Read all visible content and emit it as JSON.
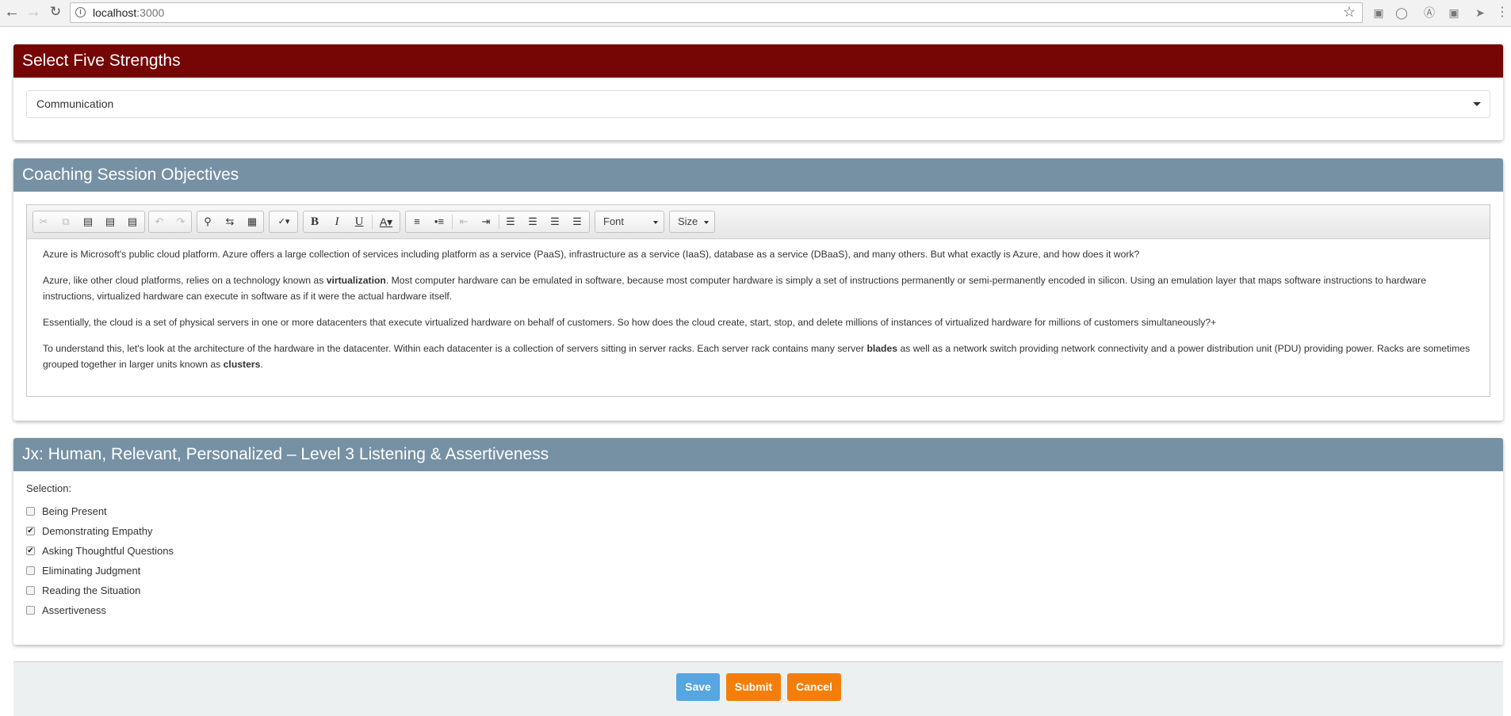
{
  "browser": {
    "url_host": "localhost",
    "url_port": ":3000"
  },
  "strengths": {
    "title": "Select Five Strengths",
    "selected": "Communication"
  },
  "objectives": {
    "title": "Coaching Session Objectives",
    "toolbar": {
      "font_label": "Font",
      "size_label": "Size"
    },
    "paragraphs": [
      {
        "text": "Azure is Microsoft's public cloud platform. Azure offers a large collection of services including platform as a service (PaaS), infrastructure as a service (IaaS), database as a service (DBaaS), and many others. But what exactly is Azure, and how does it work?"
      },
      {
        "pre": "Azure, like other cloud platforms, relies on a technology known as ",
        "bold": "virtualization",
        "post": ". Most computer hardware can be emulated in software, because most computer hardware is simply a set of instructions permanently or semi-permanently encoded in silicon. Using an emulation layer that maps software instructions to hardware instructions, virtualized hardware can execute in software as if it were the actual hardware itself."
      },
      {
        "text": "Essentially, the cloud is a set of physical servers in one or more datacenters that execute virtualized hardware on behalf of customers. So how does the cloud create, start, stop, and delete millions of instances of virtualized hardware for millions of customers simultaneously?+"
      },
      {
        "pre": "To understand this, let's look at the architecture of the hardware in the datacenter. Within each datacenter is a collection of servers sitting in server racks. Each server rack contains many server ",
        "bold": "blades",
        "mid": " as well as a network switch providing network connectivity and a power distribution unit (PDU) providing power. Racks are sometimes grouped together in larger units known as ",
        "bold2": "clusters",
        "post": "."
      }
    ]
  },
  "jx": {
    "title": "Jx: Human, Relevant, Personalized – Level 3 Listening & Assertiveness",
    "selection_label": "Selection:",
    "options": [
      {
        "label": "Being Present",
        "checked": false
      },
      {
        "label": "Demonstrating Empathy",
        "checked": true
      },
      {
        "label": "Asking Thoughtful Questions",
        "checked": true
      },
      {
        "label": "Eliminating Judgment",
        "checked": false
      },
      {
        "label": "Reading the Situation",
        "checked": false
      },
      {
        "label": "Assertiveness",
        "checked": false
      }
    ]
  },
  "actions": {
    "save": "Save",
    "submit": "Submit",
    "cancel": "Cancel"
  },
  "colors": {
    "strengths_header": "#760505",
    "section_header": "#7691a4",
    "save_button": "#56a6e1",
    "orange_button": "#f47e0b"
  }
}
